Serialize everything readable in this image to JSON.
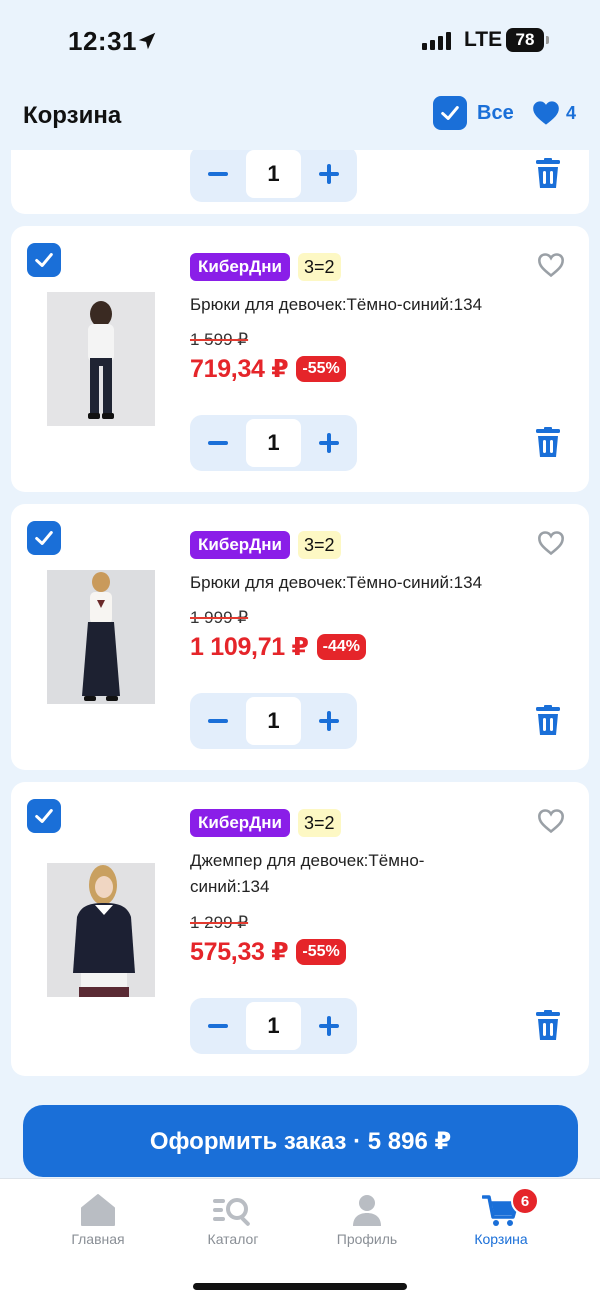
{
  "status_bar": {
    "time": "12:31",
    "network": "LTE",
    "battery": "78"
  },
  "header": {
    "title": "Корзина",
    "select_all_label": "Все",
    "favorites_count": "4"
  },
  "cart_items": [
    {
      "promo": "КиберДни",
      "deal": "3=2",
      "name": "Брюки для девочек:Тёмно-синий:134",
      "old_price": "1 599 ₽",
      "price": "719,34 ₽",
      "discount": "-55%",
      "quantity": "1"
    },
    {
      "promo": "КиберДни",
      "deal": "3=2",
      "name": "Брюки для девочек:Тёмно-синий:134",
      "old_price": "1 999 ₽",
      "price": "1 109,71 ₽",
      "discount": "-44%",
      "quantity": "1"
    },
    {
      "promo": "КиберДни",
      "deal": "3=2",
      "name": "Джемпер для девочек:Тёмно-синий:134",
      "old_price": "1 299 ₽",
      "price": "575,33 ₽",
      "discount": "-55%",
      "quantity": "1"
    }
  ],
  "partial_item": {
    "quantity": "1"
  },
  "checkout": {
    "label": "Оформить заказ · 5 896 ₽"
  },
  "tabbar": {
    "home": "Главная",
    "catalog": "Каталог",
    "profile": "Профиль",
    "cart": "Корзина",
    "cart_badge": "6"
  },
  "colors": {
    "accent": "#1a6fd8",
    "sale": "#e5252a",
    "promo": "#8a1ee8",
    "deal_bg": "#fdf8c4"
  }
}
